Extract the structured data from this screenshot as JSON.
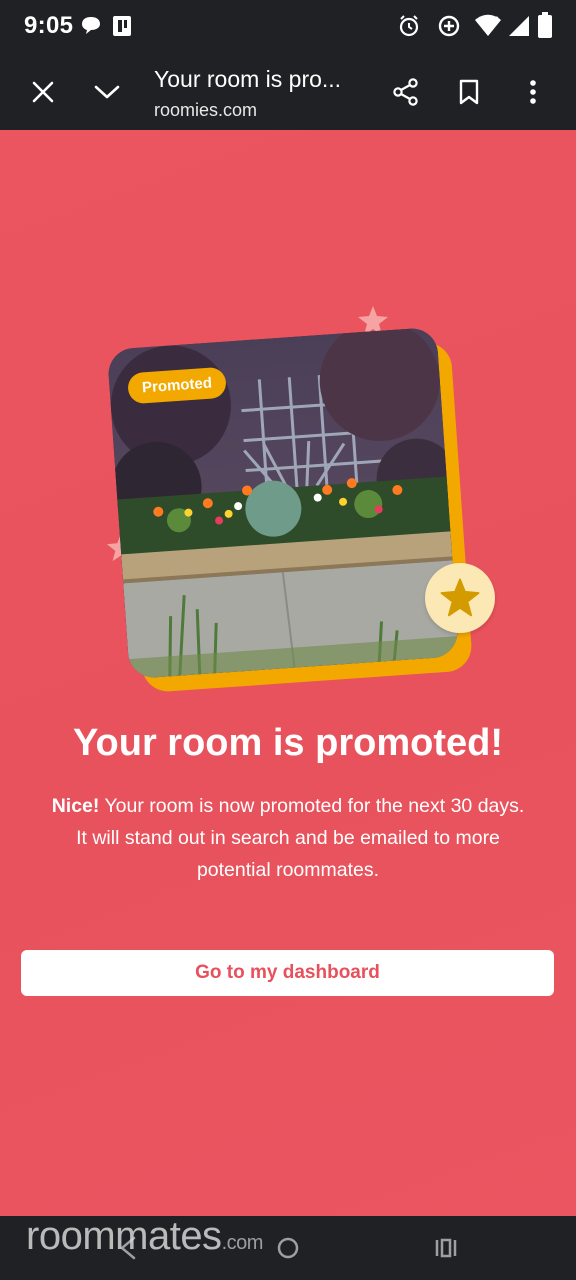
{
  "status_bar": {
    "time": "9:05",
    "icons": [
      "message-icon",
      "sim-icon",
      "alarm-icon",
      "data-saver-icon",
      "wifi-icon",
      "signal-icon",
      "battery-icon"
    ]
  },
  "toolbar": {
    "title": "Your room is pro...",
    "url": "roomies.com",
    "icons": [
      "close-icon",
      "chevron-down-icon",
      "share-icon",
      "bookmark-icon",
      "more-vert-icon"
    ]
  },
  "card": {
    "badge": "Promoted"
  },
  "content": {
    "headline": "Your room is promoted!",
    "body_bold": "Nice!",
    "body_line1": " Your room is now promoted for the next 30 days.",
    "body_line2": "It will stand out in search and be emailed to more",
    "body_line3": "potential roommates."
  },
  "cta": {
    "label": "Go to my dashboard"
  },
  "watermark": {
    "main": "roommates",
    "suffix": ".com"
  },
  "colors": {
    "background": "#ea5661",
    "accent_gold": "#f3a800",
    "cta_text": "#e8505b",
    "chrome": "#202124"
  }
}
